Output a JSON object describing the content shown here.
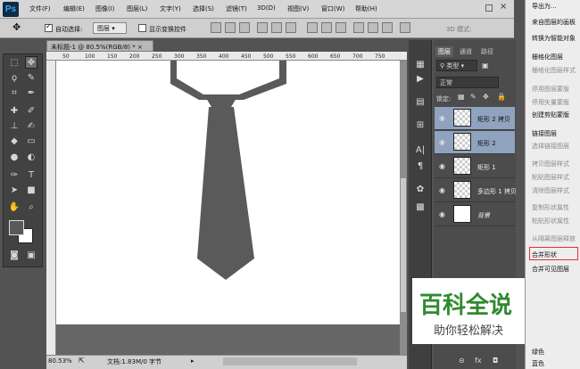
{
  "app": {
    "logo": "Ps"
  },
  "menu": [
    "文件(F)",
    "编辑(E)",
    "图像(I)",
    "图层(L)",
    "文字(Y)",
    "选择(S)",
    "滤镜(T)",
    "3D(D)",
    "视图(V)",
    "窗口(W)",
    "帮助(H)"
  ],
  "options": {
    "auto_select_label": "自动选择:",
    "auto_select_value": "图层",
    "show_transform_label": "显示变换控件",
    "mode_3d": "3D 模式:"
  },
  "document": {
    "tab_title": "未标题-1 @ 80.5%(RGB/8) *",
    "ruler_ticks": [
      "50",
      "100",
      "150",
      "200",
      "250",
      "300",
      "350",
      "400",
      "450",
      "500",
      "550",
      "600",
      "650",
      "700",
      "750"
    ],
    "zoom": "80.53%",
    "doc_info": "文档:1.83M/0 字节"
  },
  "layers_panel": {
    "tabs": [
      "图层",
      "通道",
      "路径"
    ],
    "filter_kind": "类型",
    "blend_mode": "正常",
    "lock_label": "锁定:",
    "layers": [
      {
        "name": "矩形 2 拷贝",
        "selected": true
      },
      {
        "name": "矩形 2",
        "selected": true
      },
      {
        "name": "矩形 1",
        "selected": false
      },
      {
        "name": "多边形 1 拷贝",
        "selected": false
      },
      {
        "name": "背景",
        "selected": false
      }
    ]
  },
  "context_menu": {
    "items": [
      {
        "label": "导出为...",
        "enabled": true
      },
      {
        "label": "来自图层的画板",
        "enabled": true
      },
      {
        "label": "转换为智能对象",
        "enabled": true
      },
      {
        "label": "栅格化图层",
        "enabled": true
      },
      {
        "label": "栅格化图层样式",
        "enabled": false
      },
      {
        "label": "停用图层蒙版",
        "enabled": false
      },
      {
        "label": "停用矢量蒙版",
        "enabled": false
      },
      {
        "label": "创建剪贴蒙版",
        "enabled": true
      },
      {
        "label": "链接图层",
        "enabled": true
      },
      {
        "label": "选择链接图层",
        "enabled": false
      },
      {
        "label": "拷贝图层样式",
        "enabled": false
      },
      {
        "label": "粘贴图层样式",
        "enabled": false
      },
      {
        "label": "清除图层样式",
        "enabled": false
      },
      {
        "label": "复制形状属性",
        "enabled": false
      },
      {
        "label": "粘贴形状属性",
        "enabled": false
      },
      {
        "label": "从隔离图层释放",
        "enabled": false
      },
      {
        "label": "合并形状",
        "enabled": true
      },
      {
        "label": "合并可见图层",
        "enabled": true
      },
      {
        "label": "绿色",
        "enabled": true
      },
      {
        "label": "蓝色",
        "enabled": true
      }
    ],
    "highlighted": "合并形状"
  },
  "watermark": {
    "main": "百科全说",
    "sub": "助你轻松解决"
  },
  "colors": {
    "shape": "#5a5a5a",
    "selection": "#8fa3bf",
    "highlight_box": "#e23232",
    "watermark_green": "#2f8a2f"
  }
}
